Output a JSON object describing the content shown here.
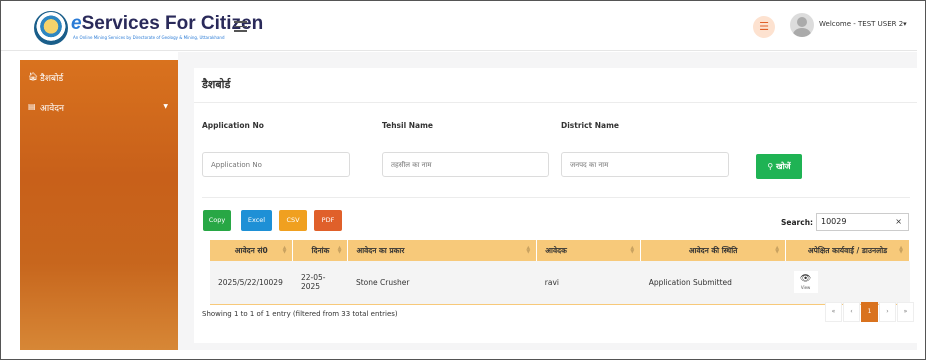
{
  "header": {
    "brand_e": "e",
    "brand_rest": "Services For Citizen",
    "brand_subtitle": "An Online Mining Services by Directorate of Geology & Mining, Uttarakhand",
    "welcome": "Welcome - TEST USER 2"
  },
  "sidebar": {
    "items": [
      {
        "label": "डैशबोर्ड",
        "icon": "home-icon"
      },
      {
        "label": "आवेदन",
        "icon": "document-icon"
      }
    ]
  },
  "main": {
    "title": "डैशबोर्ड",
    "filters": {
      "application_no": {
        "label": "Application No",
        "placeholder": "Application No"
      },
      "tehsil": {
        "label": "Tehsil Name",
        "placeholder": "तहसील का नाम"
      },
      "district": {
        "label": "District Name",
        "placeholder": "जनपद का नाम"
      },
      "search_button": "खोजें"
    },
    "export_buttons": [
      {
        "label": "Copy",
        "color": "#28a745"
      },
      {
        "label": "Excel",
        "color": "#1e90d6"
      },
      {
        "label": "CSV",
        "color": "#f0a020"
      },
      {
        "label": "PDF",
        "color": "#e0602a"
      }
    ],
    "table_search": {
      "label": "Search:",
      "value": "10029"
    },
    "table": {
      "columns": [
        "आवेदन सं0",
        "दिनांक",
        "आवेदन का प्रकार",
        "आवेदक",
        "आवेदन की स्थिति",
        "अपेक्षित कार्यवाई / डाउनलोड"
      ],
      "rows": [
        {
          "app_no": "2025/5/22/10029",
          "date_line1": "22-05-",
          "date_line2": "2025",
          "type": "Stone Crusher",
          "applicant": "ravi",
          "status": "Application Submitted",
          "action": "View"
        }
      ]
    },
    "info": "Showing 1 to 1 of 1 entry (filtered from 33 total entries)",
    "pager": [
      "«",
      "‹",
      "1",
      "›",
      "»"
    ]
  }
}
